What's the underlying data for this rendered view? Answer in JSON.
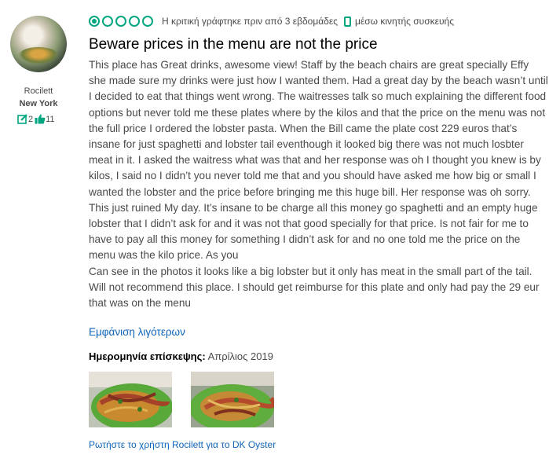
{
  "reviewer": {
    "username": "Rocilett",
    "location": "New York",
    "review_count": "2",
    "helpful_votes": "11"
  },
  "review": {
    "rating": 1,
    "rating_max": 5,
    "written_ago": "Η κριτική γράφτηκε πριν από 3 εβδομάδες",
    "via_mobile": "μέσω κινητής συσκευής",
    "title": "Beware prices in the menu are not the price",
    "body_1": "This place has Great drinks, awesome view! Staff by the beach chairs are great specially Effy she made sure my drinks were just how I wanted them. Had a great day by the beach wasn’t until I decided to eat that things went wrong. The waitresses talk so much explaining the different food options but never told me these plates where by the kilos and that the price on the menu was not the full price I ordered the lobster pasta. When the Bill came the plate cost 229 euros that’s insane for just spaghetti and lobster tail eventhough it looked big there was not much losbter meat in it. I asked the waitress what was that and her response was oh I thought you knew is by kilos, I said no I didn’t you never told me that and you should have asked me how big or small I wanted the lobster and the price before bringing me this huge bill. Her response was oh sorry. This just ruined My day. It’s insane to be charge all this money go spaghetti and an empty huge lobster that I didn’t ask for and it was not that good specially for that price. Is not fair for me to have to pay all this money for something I didn’t ask for and no one told me the price on the menu was the kilo price. As you",
    "body_2": "Can see in the photos it looks like a big lobster but it only has meat in the small part of the tail. Will not recommend this place. I should get reimburse for this plate and only had pay the 29 eur that was on the menu",
    "show_less": "Εμφάνιση λιγότερων",
    "visit_label": "Ημερομηνία επίσκεψης:",
    "visit_date": "Απρίλιος 2019",
    "ask_link": "Ρωτήστε το χρήστη Rocilett για το DK Oyster"
  },
  "colors": {
    "accent": "#00a680",
    "link": "#0e64b9"
  }
}
